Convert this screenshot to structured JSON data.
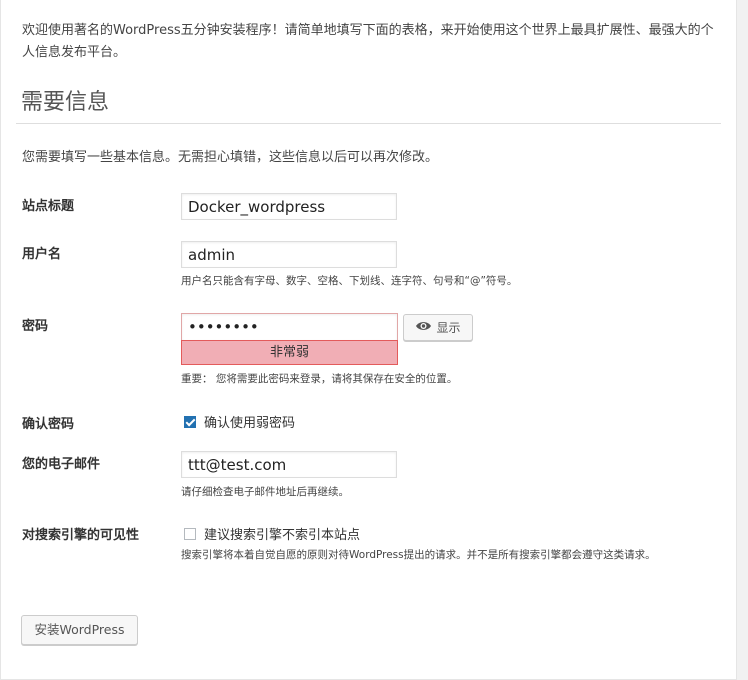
{
  "intro_text": "欢迎使用著名的WordPress五分钟安装程序！请简单地填写下面的表格，来开始使用这个世界上最具扩展性、最强大的个人信息发布平台。",
  "section_title": "需要信息",
  "section_desc": "您需要填写一些基本信息。无需担心填错，这些信息以后可以再次修改。",
  "site_title": {
    "label": "站点标题",
    "value": "Docker_wordpress"
  },
  "username": {
    "label": "用户名",
    "value": "admin",
    "hint": "用户名只能含有字母、数字、空格、下划线、连字符、句号和“@”符号。"
  },
  "password": {
    "label": "密码",
    "value": "••••••••",
    "strength": "非常弱",
    "show_label": "显示",
    "note_prefix": "重要：",
    "note": "您将需要此密码来登录，请将其保存在安全的位置。"
  },
  "confirm_password": {
    "label": "确认密码",
    "checkbox_label": "确认使用弱密码",
    "checked": true
  },
  "email": {
    "label": "您的电子邮件",
    "value": "ttt@test.com",
    "hint": "请仔细检查电子邮件地址后再继续。"
  },
  "search_visibility": {
    "label": "对搜索引擎的可见性",
    "checkbox_label": "建议搜索引擎不索引本站点",
    "checked": false,
    "hint": "搜索引擎将本着自觉自愿的原则对待WordPress提出的请求。并不是所有搜索引擎都会遵守这类请求。"
  },
  "install_button": "安装WordPress",
  "colors": {
    "strength_bg": "#f1aeb5",
    "strength_border": "#e35b5b",
    "checkbox_accent": "#2271b1"
  }
}
